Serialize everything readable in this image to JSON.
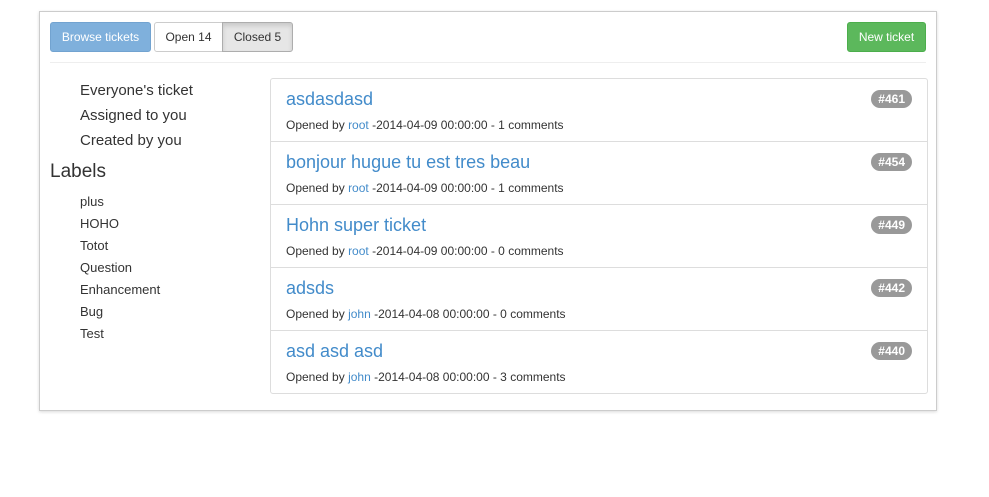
{
  "toolbar": {
    "browse_label": "Browse tickets",
    "open_label": "Open 14",
    "closed_label": "Closed 5",
    "new_label": "New ticket"
  },
  "sidebar": {
    "filters": [
      "Everyone's ticket",
      "Assigned to you",
      "Created by you"
    ],
    "labels_heading": "Labels",
    "labels": [
      "plus",
      "HOHO",
      "Totot",
      "Question",
      "Enhancement",
      "Bug",
      "Test"
    ]
  },
  "tickets": [
    {
      "title": "asdasdasd",
      "number": "#461",
      "opened_by": "Opened by",
      "author": "root",
      "meta": "-2014-04-09 00:00:00 - 1 comments"
    },
    {
      "title": "bonjour hugue tu est tres beau",
      "number": "#454",
      "opened_by": "Opened by",
      "author": "root",
      "meta": "-2014-04-09 00:00:00 - 1 comments"
    },
    {
      "title": "Hohn super ticket",
      "number": "#449",
      "opened_by": "Opened by",
      "author": "root",
      "meta": "-2014-04-09 00:00:00 - 0 comments"
    },
    {
      "title": "adsds",
      "number": "#442",
      "opened_by": "Opened by",
      "author": "john",
      "meta": "-2014-04-08 00:00:00 - 0 comments"
    },
    {
      "title": "asd asd asd",
      "number": "#440",
      "opened_by": "Opened by",
      "author": "john",
      "meta": "-2014-04-08 00:00:00 - 3 comments"
    }
  ],
  "colors": {
    "primary": "#428bca",
    "browse_button": "#7fb0dc",
    "success": "#5cb85c",
    "badge": "#999999"
  }
}
